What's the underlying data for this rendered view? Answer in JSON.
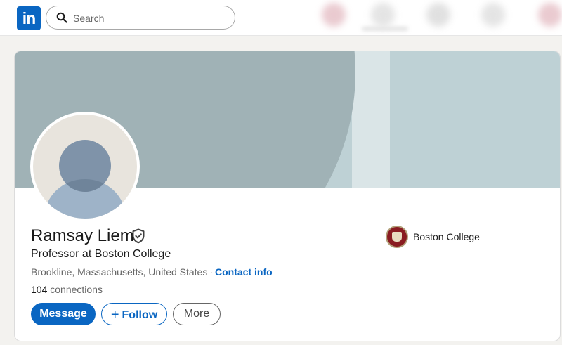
{
  "nav": {
    "logo_text": "in",
    "search_placeholder": "Search"
  },
  "profile": {
    "name": "Ramsay Liem",
    "headline": "Professor at Boston College",
    "location": "Brookline, Massachusetts, United States",
    "separator": "·",
    "contact_label": "Contact info",
    "connections_count": "104",
    "connections_label": "connections",
    "organization": "Boston College"
  },
  "actions": {
    "message": "Message",
    "follow_plus": "+",
    "follow": "Follow",
    "more": "More"
  },
  "colors": {
    "brand": "#0a66c2",
    "banner_light": "#bed1d5",
    "banner_dark": "#a0b2b6"
  }
}
